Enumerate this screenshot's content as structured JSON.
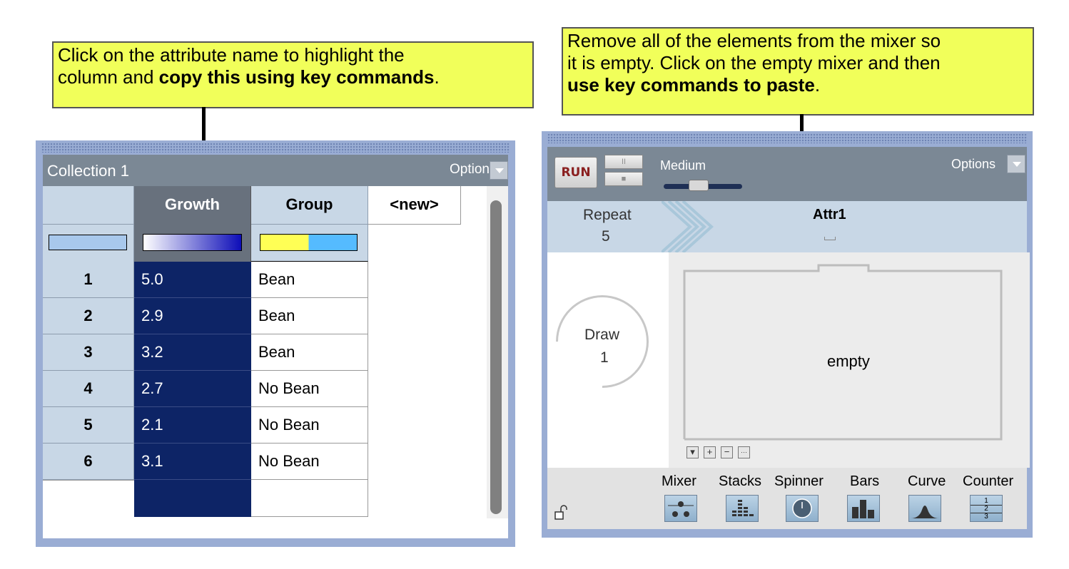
{
  "callouts": {
    "left": {
      "line1": "Click on the attribute name to highlight the",
      "line2_plain": "column and ",
      "line2_bold": "copy this using key commands",
      "line2_end": "."
    },
    "right": {
      "line1": "Remove all of the elements from the mixer so",
      "line2": "it is empty. Click on the empty mixer and then",
      "line3_bold": "use key commands to paste",
      "line3_end": "."
    }
  },
  "table": {
    "title": "Collection 1",
    "options_label": "Options",
    "headers": [
      "",
      "Growth",
      "Group",
      "<new>"
    ],
    "rows": [
      {
        "index": "1",
        "growth": "5.0",
        "group": "Bean"
      },
      {
        "index": "2",
        "growth": "2.9",
        "group": "Bean"
      },
      {
        "index": "3",
        "growth": "3.2",
        "group": "Bean"
      },
      {
        "index": "4",
        "growth": "2.7",
        "group": "No Bean"
      },
      {
        "index": "5",
        "growth": "2.1",
        "group": "No Bean"
      },
      {
        "index": "6",
        "growth": "3.1",
        "group": "No Bean"
      }
    ],
    "colors": {
      "index_swatch": "#a8c8ec",
      "growth_dark": "#0d0db8",
      "group_yellow": "#ffff55",
      "group_blue": "#55bbff",
      "selected_column": "#0d2466"
    }
  },
  "sampler": {
    "run_label": "RUN",
    "pause_label": "II",
    "stop_label": "■",
    "speed_label": "Medium",
    "options_label": "Options",
    "repeat_label": "Repeat",
    "repeat_value": "5",
    "attr_label": "Attr1",
    "draw_label": "Draw",
    "draw_value": "1",
    "mixer_text": "empty",
    "mini_buttons": [
      "▾",
      "+",
      "−",
      "···"
    ],
    "tools": [
      "Mixer",
      "Stacks",
      "Spinner",
      "Bars",
      "Curve",
      "Counter"
    ],
    "counter_digits": [
      "1",
      "2",
      "3"
    ],
    "icons": {
      "lock": "unlock-icon"
    }
  }
}
